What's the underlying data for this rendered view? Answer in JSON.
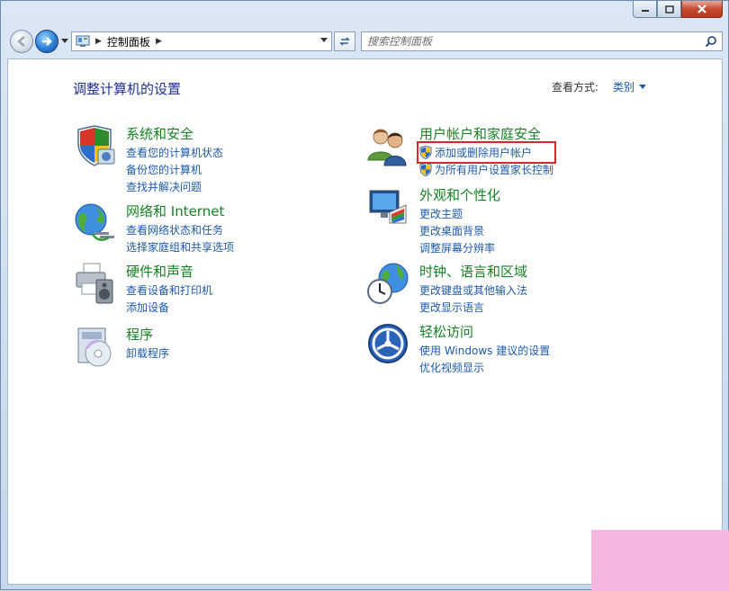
{
  "window": {
    "accent_close": "#c74b32"
  },
  "address_bar": {
    "path": [
      "控制面板"
    ]
  },
  "search": {
    "placeholder": "搜索控制面板"
  },
  "page": {
    "title": "调整计算机的设置",
    "view_by_label": "查看方式:",
    "view_by_value": "类别"
  },
  "categories": {
    "system_security": {
      "icon": "shield-pc-icon",
      "title": "系统和安全",
      "links": [
        "查看您的计算机状态",
        "备份您的计算机",
        "查找并解决问题"
      ]
    },
    "network_internet": {
      "icon": "globe-network-icon",
      "title": "网络和 Internet",
      "links": [
        "查看网络状态和任务",
        "选择家庭组和共享选项"
      ]
    },
    "hardware_sound": {
      "icon": "printer-speaker-icon",
      "title": "硬件和声音",
      "links": [
        "查看设备和打印机",
        "添加设备"
      ]
    },
    "programs": {
      "icon": "programs-disc-icon",
      "title": "程序",
      "links": [
        "卸载程序"
      ]
    },
    "user_accounts": {
      "icon": "users-icon",
      "title": "用户帐户和家庭安全",
      "links": [
        "添加或删除用户帐户",
        "为所有用户设置家长控制"
      ]
    },
    "appearance": {
      "icon": "monitor-palette-icon",
      "title": "外观和个性化",
      "links": [
        "更改主题",
        "更改桌面背景",
        "调整屏幕分辨率"
      ]
    },
    "clock_region": {
      "icon": "clock-globe-icon",
      "title": "时钟、语言和区域",
      "links": [
        "更改键盘或其他输入法",
        "更改显示语言"
      ]
    },
    "ease_of_access": {
      "icon": "ease-of-access-icon",
      "title": "轻松访问",
      "links": [
        "使用 Windows 建议的设置",
        "优化视频显示"
      ]
    }
  },
  "colors": {
    "category_title": "#168225",
    "link": "#1e5aa8",
    "highlight_box": "#d7262c"
  }
}
